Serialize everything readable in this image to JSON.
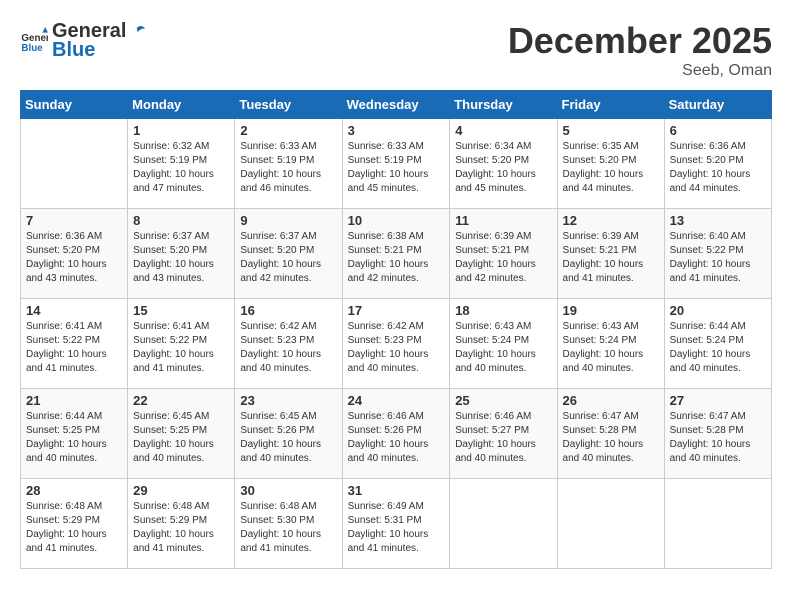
{
  "logo": {
    "general": "General",
    "blue": "Blue"
  },
  "title": "December 2025",
  "location": "Seeb, Oman",
  "weekdays": [
    "Sunday",
    "Monday",
    "Tuesday",
    "Wednesday",
    "Thursday",
    "Friday",
    "Saturday"
  ],
  "weeks": [
    [
      {
        "day": "",
        "sunrise": "",
        "sunset": "",
        "daylight": ""
      },
      {
        "day": "1",
        "sunrise": "Sunrise: 6:32 AM",
        "sunset": "Sunset: 5:19 PM",
        "daylight": "Daylight: 10 hours and 47 minutes."
      },
      {
        "day": "2",
        "sunrise": "Sunrise: 6:33 AM",
        "sunset": "Sunset: 5:19 PM",
        "daylight": "Daylight: 10 hours and 46 minutes."
      },
      {
        "day": "3",
        "sunrise": "Sunrise: 6:33 AM",
        "sunset": "Sunset: 5:19 PM",
        "daylight": "Daylight: 10 hours and 45 minutes."
      },
      {
        "day": "4",
        "sunrise": "Sunrise: 6:34 AM",
        "sunset": "Sunset: 5:20 PM",
        "daylight": "Daylight: 10 hours and 45 minutes."
      },
      {
        "day": "5",
        "sunrise": "Sunrise: 6:35 AM",
        "sunset": "Sunset: 5:20 PM",
        "daylight": "Daylight: 10 hours and 44 minutes."
      },
      {
        "day": "6",
        "sunrise": "Sunrise: 6:36 AM",
        "sunset": "Sunset: 5:20 PM",
        "daylight": "Daylight: 10 hours and 44 minutes."
      }
    ],
    [
      {
        "day": "7",
        "sunrise": "Sunrise: 6:36 AM",
        "sunset": "Sunset: 5:20 PM",
        "daylight": "Daylight: 10 hours and 43 minutes."
      },
      {
        "day": "8",
        "sunrise": "Sunrise: 6:37 AM",
        "sunset": "Sunset: 5:20 PM",
        "daylight": "Daylight: 10 hours and 43 minutes."
      },
      {
        "day": "9",
        "sunrise": "Sunrise: 6:37 AM",
        "sunset": "Sunset: 5:20 PM",
        "daylight": "Daylight: 10 hours and 42 minutes."
      },
      {
        "day": "10",
        "sunrise": "Sunrise: 6:38 AM",
        "sunset": "Sunset: 5:21 PM",
        "daylight": "Daylight: 10 hours and 42 minutes."
      },
      {
        "day": "11",
        "sunrise": "Sunrise: 6:39 AM",
        "sunset": "Sunset: 5:21 PM",
        "daylight": "Daylight: 10 hours and 42 minutes."
      },
      {
        "day": "12",
        "sunrise": "Sunrise: 6:39 AM",
        "sunset": "Sunset: 5:21 PM",
        "daylight": "Daylight: 10 hours and 41 minutes."
      },
      {
        "day": "13",
        "sunrise": "Sunrise: 6:40 AM",
        "sunset": "Sunset: 5:22 PM",
        "daylight": "Daylight: 10 hours and 41 minutes."
      }
    ],
    [
      {
        "day": "14",
        "sunrise": "Sunrise: 6:41 AM",
        "sunset": "Sunset: 5:22 PM",
        "daylight": "Daylight: 10 hours and 41 minutes."
      },
      {
        "day": "15",
        "sunrise": "Sunrise: 6:41 AM",
        "sunset": "Sunset: 5:22 PM",
        "daylight": "Daylight: 10 hours and 41 minutes."
      },
      {
        "day": "16",
        "sunrise": "Sunrise: 6:42 AM",
        "sunset": "Sunset: 5:23 PM",
        "daylight": "Daylight: 10 hours and 40 minutes."
      },
      {
        "day": "17",
        "sunrise": "Sunrise: 6:42 AM",
        "sunset": "Sunset: 5:23 PM",
        "daylight": "Daylight: 10 hours and 40 minutes."
      },
      {
        "day": "18",
        "sunrise": "Sunrise: 6:43 AM",
        "sunset": "Sunset: 5:24 PM",
        "daylight": "Daylight: 10 hours and 40 minutes."
      },
      {
        "day": "19",
        "sunrise": "Sunrise: 6:43 AM",
        "sunset": "Sunset: 5:24 PM",
        "daylight": "Daylight: 10 hours and 40 minutes."
      },
      {
        "day": "20",
        "sunrise": "Sunrise: 6:44 AM",
        "sunset": "Sunset: 5:24 PM",
        "daylight": "Daylight: 10 hours and 40 minutes."
      }
    ],
    [
      {
        "day": "21",
        "sunrise": "Sunrise: 6:44 AM",
        "sunset": "Sunset: 5:25 PM",
        "daylight": "Daylight: 10 hours and 40 minutes."
      },
      {
        "day": "22",
        "sunrise": "Sunrise: 6:45 AM",
        "sunset": "Sunset: 5:25 PM",
        "daylight": "Daylight: 10 hours and 40 minutes."
      },
      {
        "day": "23",
        "sunrise": "Sunrise: 6:45 AM",
        "sunset": "Sunset: 5:26 PM",
        "daylight": "Daylight: 10 hours and 40 minutes."
      },
      {
        "day": "24",
        "sunrise": "Sunrise: 6:46 AM",
        "sunset": "Sunset: 5:26 PM",
        "daylight": "Daylight: 10 hours and 40 minutes."
      },
      {
        "day": "25",
        "sunrise": "Sunrise: 6:46 AM",
        "sunset": "Sunset: 5:27 PM",
        "daylight": "Daylight: 10 hours and 40 minutes."
      },
      {
        "day": "26",
        "sunrise": "Sunrise: 6:47 AM",
        "sunset": "Sunset: 5:28 PM",
        "daylight": "Daylight: 10 hours and 40 minutes."
      },
      {
        "day": "27",
        "sunrise": "Sunrise: 6:47 AM",
        "sunset": "Sunset: 5:28 PM",
        "daylight": "Daylight: 10 hours and 40 minutes."
      }
    ],
    [
      {
        "day": "28",
        "sunrise": "Sunrise: 6:48 AM",
        "sunset": "Sunset: 5:29 PM",
        "daylight": "Daylight: 10 hours and 41 minutes."
      },
      {
        "day": "29",
        "sunrise": "Sunrise: 6:48 AM",
        "sunset": "Sunset: 5:29 PM",
        "daylight": "Daylight: 10 hours and 41 minutes."
      },
      {
        "day": "30",
        "sunrise": "Sunrise: 6:48 AM",
        "sunset": "Sunset: 5:30 PM",
        "daylight": "Daylight: 10 hours and 41 minutes."
      },
      {
        "day": "31",
        "sunrise": "Sunrise: 6:49 AM",
        "sunset": "Sunset: 5:31 PM",
        "daylight": "Daylight: 10 hours and 41 minutes."
      },
      {
        "day": "",
        "sunrise": "",
        "sunset": "",
        "daylight": ""
      },
      {
        "day": "",
        "sunrise": "",
        "sunset": "",
        "daylight": ""
      },
      {
        "day": "",
        "sunrise": "",
        "sunset": "",
        "daylight": ""
      }
    ]
  ]
}
